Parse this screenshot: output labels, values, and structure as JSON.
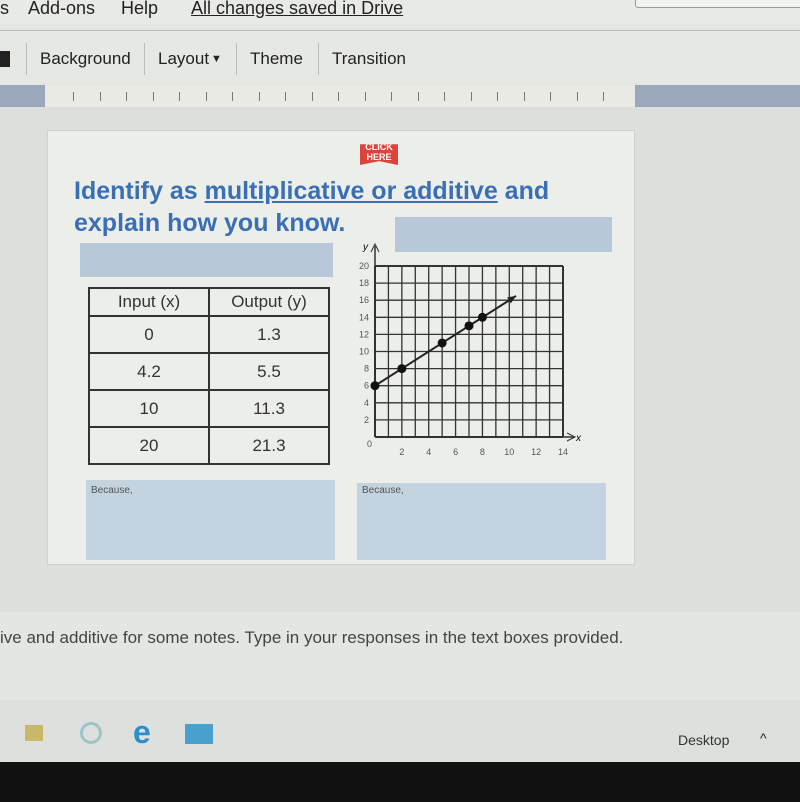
{
  "menubar": {
    "items": [
      "s",
      "Add-ons",
      "Help"
    ],
    "save_status": "All changes saved in Drive"
  },
  "toolbar": {
    "background": "Background",
    "layout": "Layout",
    "theme": "Theme",
    "transition": "Transition"
  },
  "slide": {
    "badge": "CLICK HERE",
    "title_pre": "Identify as ",
    "title_link": "multiplicative or additive",
    "title_post": " and explain how you know.",
    "table": {
      "headers": [
        "Input (x)",
        "Output (y)"
      ],
      "rows": [
        [
          "0",
          "1.3"
        ],
        [
          "4.2",
          "5.5"
        ],
        [
          "10",
          "11.3"
        ],
        [
          "20",
          "21.3"
        ]
      ]
    },
    "because_left": "Because,",
    "because_right": "Because,",
    "accent": "#3b6fb5"
  },
  "chart_data": {
    "type": "line",
    "xlabel": "x",
    "ylabel": "y",
    "xlim": [
      0,
      14
    ],
    "ylim": [
      0,
      20
    ],
    "xticks": [
      2,
      4,
      6,
      8,
      10,
      12,
      14
    ],
    "yticks": [
      2,
      4,
      6,
      8,
      10,
      12,
      14,
      16,
      18,
      20
    ],
    "origin_label": "0",
    "grid": true,
    "points": [
      [
        0,
        6
      ],
      [
        2,
        8
      ],
      [
        5,
        11
      ],
      [
        7,
        13
      ],
      [
        8,
        14
      ]
    ],
    "arrow_to": [
      10.5,
      16.5
    ]
  },
  "notes": "ive and additive for some notes. Type in your responses in the text boxes provided.",
  "taskbar": {
    "desktop": "Desktop",
    "icons": [
      "file-explorer-icon",
      "edge-icon",
      "ie-icon",
      "mail-icon"
    ]
  }
}
